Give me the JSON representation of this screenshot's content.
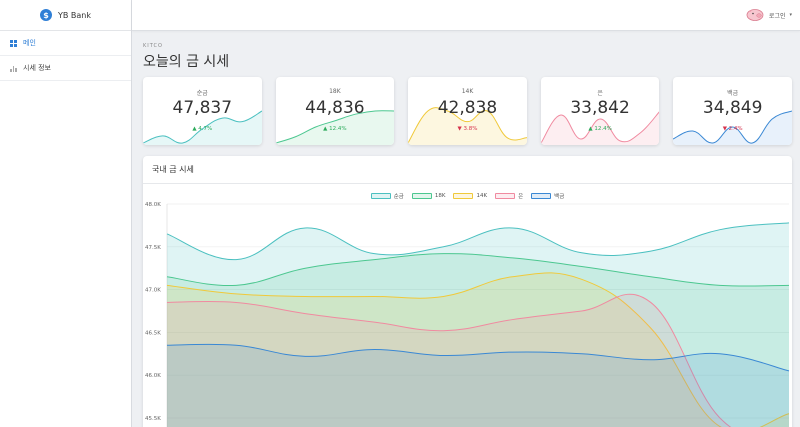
{
  "brand": {
    "name": "YB Bank",
    "logo_glyph": "$"
  },
  "sidebar": {
    "items": [
      {
        "label": "메인",
        "icon": "grid-icon",
        "active": true
      },
      {
        "label": "시세 정보",
        "icon": "bar-chart-icon",
        "active": false
      }
    ]
  },
  "topbar": {
    "login_label": "로그인",
    "caret": "▾"
  },
  "page": {
    "subtitle": "KITCO",
    "title": "오늘의 금 시세"
  },
  "cards": [
    {
      "label": "순금",
      "value": "47,837",
      "change": "▲ 4.7%",
      "direction": "up",
      "color": "#4bc0c0",
      "fill": "#e6f7f7",
      "spark": [
        46.9,
        47.1,
        46.9,
        47.3,
        47.6,
        47.5,
        47.8
      ]
    },
    {
      "label": "18K",
      "value": "44,836",
      "change": "▲ 12.4%",
      "direction": "up",
      "color": "#4cc790",
      "fill": "#e8f8ef",
      "spark": [
        43.8,
        44.0,
        44.3,
        44.5,
        44.7,
        44.8,
        44.8
      ]
    },
    {
      "label": "14K",
      "value": "42,838",
      "change": "▼ 3.8%",
      "direction": "down",
      "color": "#f0c93a",
      "fill": "#fdf7e0",
      "spark": [
        42.6,
        43.2,
        43.2,
        43.0,
        43.2,
        42.7,
        42.7
      ]
    },
    {
      "label": "은",
      "value": "33,842",
      "change": "▲ 12.4%",
      "direction": "up",
      "color": "#f08aa0",
      "fill": "#fdeef1",
      "spark": [
        32.8,
        34.2,
        33.0,
        34.0,
        32.9,
        33.3,
        34.4
      ]
    },
    {
      "label": "백금",
      "value": "34,849",
      "change": "▼ 2.4%",
      "direction": "down",
      "color": "#3a88d4",
      "fill": "#e8f1fb",
      "spark": [
        34.5,
        34.7,
        34.4,
        34.8,
        34.4,
        35.0,
        35.2
      ]
    }
  ],
  "colors": {
    "up": "#2dab5c",
    "down": "#d6334d"
  },
  "chart_panel": {
    "title": "국내 금 시세"
  },
  "chart_data": {
    "type": "area",
    "title": "국내 금 시세",
    "ylim": [
      45.5,
      48.0
    ],
    "y_ticks": [
      "48.0K",
      "47.5K",
      "47.0K",
      "46.5K",
      "46.0K",
      "45.5K"
    ],
    "y_tick_values": [
      48.0,
      47.5,
      47.0,
      46.5,
      46.0,
      45.5
    ],
    "legend_position": "top-center",
    "grid": true,
    "series": [
      {
        "name": "순금",
        "color": "#4bc0c0",
        "fill": "rgba(75,192,192,0.18)",
        "values": [
          47.65,
          47.35,
          47.72,
          47.42,
          47.5,
          47.72,
          47.43,
          47.45,
          47.7,
          47.78
        ]
      },
      {
        "name": "18K",
        "color": "#4cc790",
        "fill": "rgba(76,199,144,0.16)",
        "values": [
          47.15,
          47.05,
          47.25,
          47.35,
          47.42,
          47.37,
          47.27,
          47.15,
          47.05,
          47.05
        ]
      },
      {
        "name": "14K",
        "color": "#f0c93a",
        "fill": "rgba(240,201,58,0.16)",
        "values": [
          47.05,
          46.95,
          46.92,
          46.92,
          46.92,
          47.15,
          47.12,
          46.55,
          45.4,
          45.55
        ]
      },
      {
        "name": "은",
        "color": "#f08aa0",
        "fill": "rgba(240,138,160,0.16)",
        "values": [
          46.85,
          46.85,
          46.72,
          46.62,
          46.52,
          46.65,
          46.75,
          46.85,
          45.5,
          45.2
        ]
      },
      {
        "name": "백금",
        "color": "#3a88d4",
        "fill": "rgba(58,136,212,0.16)",
        "values": [
          46.35,
          46.35,
          46.22,
          46.3,
          46.23,
          46.27,
          46.25,
          46.18,
          46.25,
          46.05
        ]
      }
    ]
  }
}
